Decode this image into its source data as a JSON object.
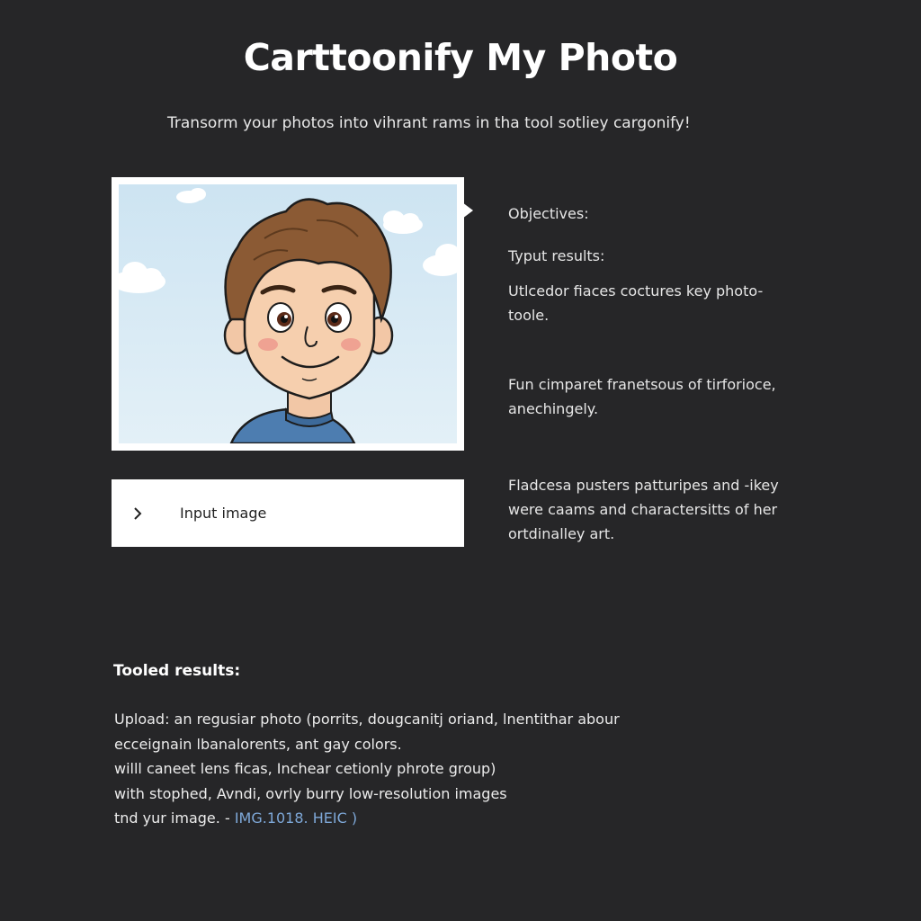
{
  "page": {
    "title": "Carttoonify My Photo",
    "subtitle": "Transorm your photos into vihrant rams in tha tool sotliey cargonify!"
  },
  "preview": {
    "icons": [
      "cartoon-portrait",
      "cloud-icon"
    ]
  },
  "input": {
    "label": "Input image",
    "icon": "chevron-right-icon"
  },
  "sidebar": {
    "objectives_heading": "Objectives:",
    "results_heading": "Typut results:",
    "paragraphs": [
      [
        "Utlcedor fiaces coctures key photo-",
        "toole."
      ],
      [
        "Fun cimparet franetsous of tirforioce,",
        "anechingely."
      ],
      [
        "Fladcesa pusters patturipes and -ikey",
        "were caams and charactersitts of her",
        "ortdinalley art."
      ]
    ]
  },
  "tooled": {
    "heading": "Tooled results:",
    "lines": [
      "Upload: an regusiar photo (porrits, dougcanitj oriand, lnentithar abour",
      "ecceignain lbanalorents, ant gay colors.",
      "willl caneet lens ficas, Inchear cetionly phrote group)",
      "with stophed, Avndi, ovrly burry low-resolution images"
    ],
    "last_line_prefix": "tnd yur image. -",
    "file_name": "IMG.1018. HEIC",
    "last_line_suffix": ")"
  },
  "colors": {
    "background": "#262628",
    "link": "#7ea8d8",
    "sky": "#cfe6f3"
  }
}
